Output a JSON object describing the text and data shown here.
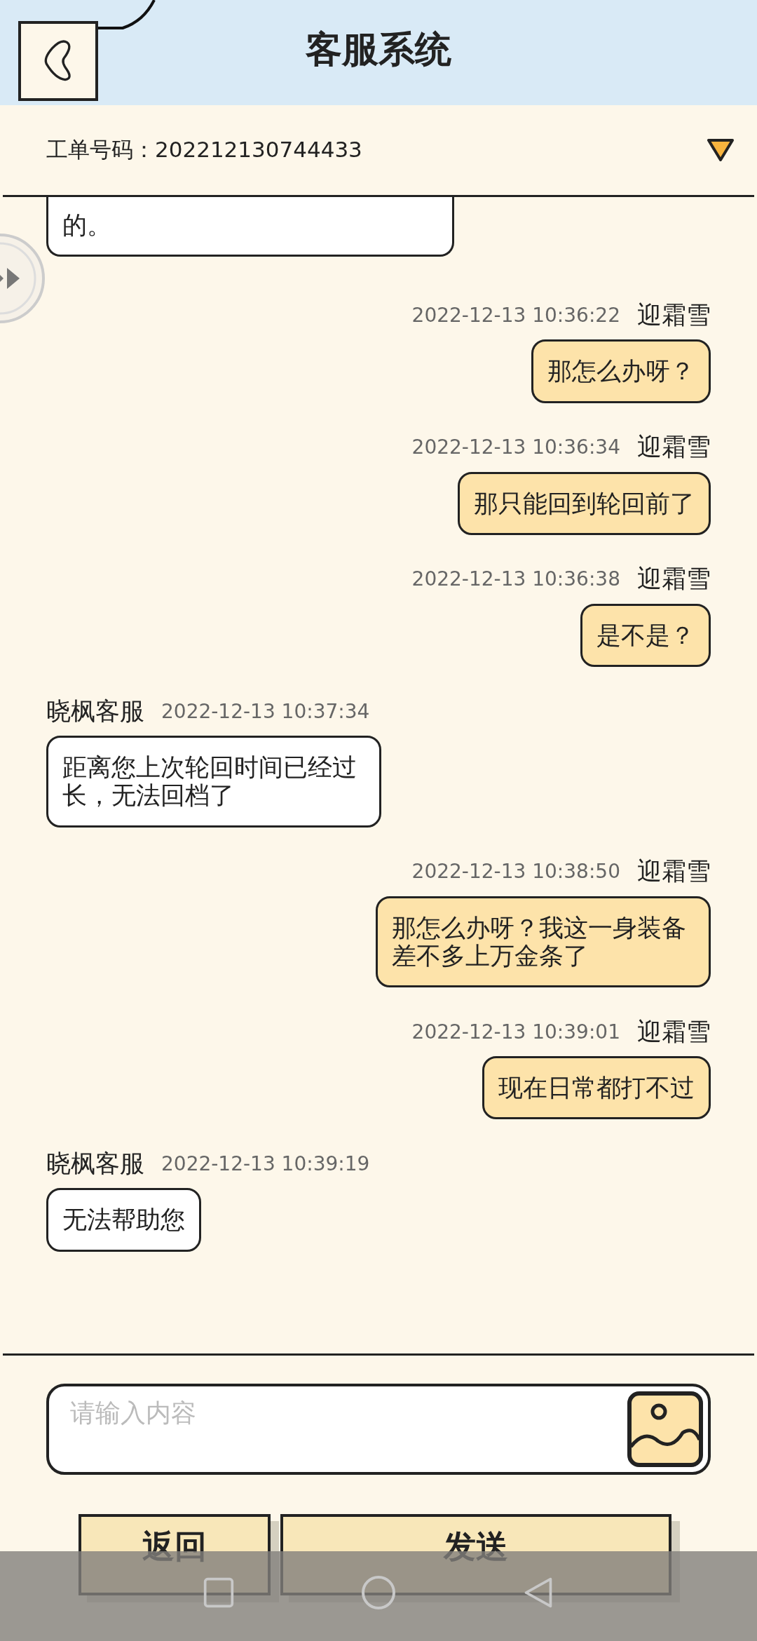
{
  "header": {
    "title": "客服系统"
  },
  "ticket": {
    "label": "工单号码：",
    "number": "202212130744433",
    "expanded": false
  },
  "messages": [
    {
      "kind": "theirs",
      "cut": true,
      "text": "的。"
    },
    {
      "kind": "mine",
      "cut": false,
      "name": "迎霜雪",
      "time": "2022-12-13 10:36:22",
      "text": "那怎么办呀？"
    },
    {
      "kind": "mine",
      "cut": false,
      "name": "迎霜雪",
      "time": "2022-12-13 10:36:34",
      "text": "那只能回到轮回前了"
    },
    {
      "kind": "mine",
      "cut": false,
      "name": "迎霜雪",
      "time": "2022-12-13 10:36:38",
      "text": "是不是？"
    },
    {
      "kind": "theirs",
      "cut": false,
      "name": "晓枫客服",
      "time": "2022-12-13 10:37:34",
      "text": "距离您上次轮回时间已经过长，无法回档了"
    },
    {
      "kind": "mine",
      "cut": false,
      "name": "迎霜雪",
      "time": "2022-12-13 10:38:50",
      "text": "那怎么办呀？我这一身装备差不多上万金条了"
    },
    {
      "kind": "mine",
      "cut": false,
      "name": "迎霜雪",
      "time": "2022-12-13 10:39:01",
      "text": "现在日常都打不过"
    },
    {
      "kind": "theirs",
      "cut": false,
      "name": "晓枫客服",
      "time": "2022-12-13 10:39:19",
      "text": "无法帮助您"
    }
  ],
  "input": {
    "placeholder": "请输入内容"
  },
  "buttons": [
    "返回",
    "发送"
  ]
}
